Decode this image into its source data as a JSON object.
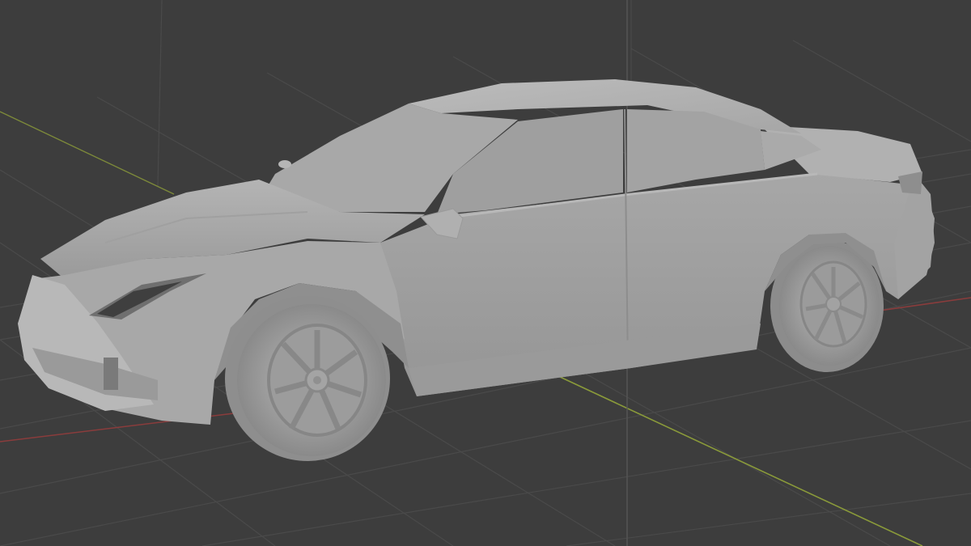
{
  "viewport": {
    "shading": "solid",
    "background_color": "#3d3d3d",
    "grid_color": "#4a4a4a",
    "axis_x_color": "#8a3c3c",
    "axis_y_color": "#8a9a3a",
    "axis_z_color": "#5a5a5a"
  },
  "scene": {
    "object": "car-sedan-mesh",
    "material_color": "#a9a9a9"
  }
}
